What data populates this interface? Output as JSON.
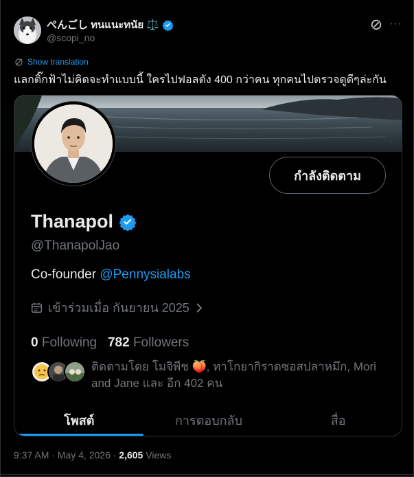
{
  "author": {
    "display_name": "ぺんごし ทนแนะทนัย ⚖️",
    "username": "@scopi_no",
    "verified": true
  },
  "translation_link": "Show translation",
  "tweet_text": "แลกติ๊กฟ้าไม่คิดจะทำแบบนี้ ใครไปฟอลตัง 400 กว่าคน ทุกคนไปตรวจดูดีๆล่ะกัน",
  "profile_card": {
    "follow_button_label": "กำลังติดตาม",
    "name": "Thanapol",
    "handle": "@ThanapolJao",
    "bio_prefix": "Co-founder ",
    "bio_mention": "@Pennysialabs",
    "joined": "เข้าร่วมเมื่อ กันยายน 2025",
    "following_count": "0",
    "following_label": "Following",
    "followers_count": "782",
    "followers_label": "Followers",
    "followed_by": "ติดตามโดย โมจิพีช 🍑, ทาโกยากิราดซอสปลาหมึก, Mori and Jane และ อีก 402 คน",
    "tabs": [
      {
        "label": "โพสต์",
        "active": true
      },
      {
        "label": "การตอบกลับ",
        "active": false
      },
      {
        "label": "สื่อ",
        "active": false
      }
    ]
  },
  "meta": {
    "time_date": "9:37 AM · May 4, 2026 · ",
    "views_count": "2,605",
    "views_label": " Views"
  },
  "colors": {
    "background": "#000000",
    "accent": "#1d9bf0",
    "text_primary": "#e7e9ea",
    "text_secondary": "#71767b",
    "border": "#2f3336"
  },
  "icons": [
    "verified-badge-icon",
    "gavel-emoji",
    "grok-icon",
    "more-icon",
    "translate-icon",
    "calendar-icon",
    "chevron-right-icon"
  ]
}
